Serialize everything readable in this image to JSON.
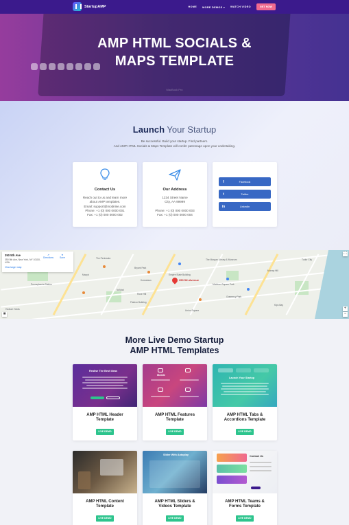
{
  "nav": {
    "brand": "StartupAMP",
    "items": [
      "HOME",
      "MORE DEMOS ▾",
      "WATCH VIDEO"
    ],
    "cta": "GET NOW"
  },
  "hero": {
    "title_line1": "AMP HTML SOCIALS &",
    "title_line2": "MAPS TEMPLATE",
    "bg_caption": "MacBook Pro"
  },
  "launch": {
    "title_bold": "Launch",
    "title_rest": " Your Startup",
    "desc_line1": "Be successful. Build your startup. Find partners.",
    "desc_line2": "And AMP HTML Socials & Maps Template will confer patronage upon your undertaking."
  },
  "contact": {
    "title": "Contact Us",
    "lines": [
      "Reach out to us and learn more",
      "about AMP templates.",
      "Email: support@mobirise.com",
      "Phone: +1 (0) 000 0000 001",
      "Fax: +1 (0) 000 0000 002"
    ]
  },
  "address": {
    "title": "Our Address",
    "lines": [
      "1234 Street Name",
      "City, AA 99999",
      "",
      "Phone: +1 (0) 000 0000 003",
      "Fax: +1 (0) 000 0000 004"
    ]
  },
  "social": {
    "buttons": [
      {
        "icon": "f",
        "label": "Facebook"
      },
      {
        "icon": "t",
        "label": "Twitter"
      },
      {
        "icon": "in",
        "label": "LinkedIn"
      }
    ]
  },
  "map": {
    "info_title": "350 5th Ave",
    "info_addr": "350 5th Ave, New York, NY 10118, USA",
    "info_link": "View larger map",
    "directions": "Directions",
    "save": "Save",
    "pin_label": "350 5th Avenue",
    "labels": [
      "Pennsylvania Station",
      "Madison Square Park",
      "Bryant Park",
      "Koreatown",
      "Macy's",
      "The Morgan Library & Museum",
      "Flatiron Building",
      "Union Square",
      "Gramercy Park",
      "Empire State Building",
      "The Peninsula",
      "Kips Bay",
      "NoMad",
      "Murray Hill",
      "Rose Hill",
      "Tudor City",
      "Hudson Yards"
    ]
  },
  "more": {
    "title_line1": "More Live Demo Startup",
    "title_line2": "AMP HTML Templates",
    "button": "LIVE DEMO",
    "templates": [
      {
        "name_line1": "AMP HTML Header",
        "name_line2": "Template",
        "thumb_text": "Realise The Best Ideas"
      },
      {
        "name_line1": "AMP HTML Features",
        "name_line2": "Template",
        "thumb_text": "Mobile"
      },
      {
        "name_line1": "AMP HTML Tabs &",
        "name_line2": "Accordions Template",
        "thumb_text": "Launch Your Startup"
      },
      {
        "name_line1": "AMP HTML Content",
        "name_line2": "Template",
        "thumb_text": ""
      },
      {
        "name_line1": "AMP HTML Sliders &",
        "name_line2": "Videos Template",
        "thumb_text": "Slider With Autoplay"
      },
      {
        "name_line1": "AMP HTML Teams &",
        "name_line2": "Forms Template",
        "thumb_text": "Contact Us"
      }
    ]
  },
  "colors": {
    "nav_bg": "#3b1a8c",
    "cta": "#f06a8f",
    "social_btn": "#3868c4",
    "live_btn": "#2dc48d",
    "pin": "#e53935"
  }
}
